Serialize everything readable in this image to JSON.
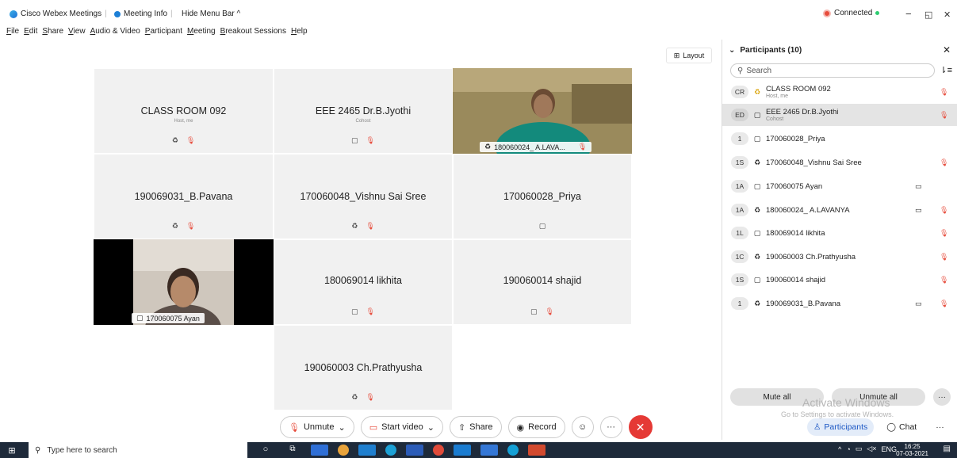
{
  "titlebar": {
    "app_name": "Cisco Webex Meetings",
    "meeting_info": "Meeting Info",
    "hide_menu": "Hide Menu Bar ^",
    "status": "Connected",
    "win_min": "−",
    "win_max": "◱",
    "win_close": "✕"
  },
  "menu": [
    "File",
    "Edit",
    "Share",
    "View",
    "Audio & Video",
    "Participant",
    "Meeting",
    "Breakout Sessions",
    "Help"
  ],
  "layout_label": "Layout",
  "tiles": {
    "classroom": {
      "name": "CLASS ROOM 092",
      "role": "Host, me"
    },
    "eee": {
      "name": "EEE 2465 Dr.B.Jyothi",
      "role": "Cohost"
    },
    "lavanya": {
      "name": "180060024_ A.LAVA..."
    },
    "pavana": {
      "name": "190069031_B.Pavana"
    },
    "vishnu": {
      "name": "170060048_Vishnu Sai Sree"
    },
    "priya": {
      "name": "170060028_Priya"
    },
    "ayan": {
      "name": "170060075 Ayan"
    },
    "likhita": {
      "name": "180069014 likhita"
    },
    "shajid": {
      "name": "190060014 shajid"
    },
    "prathyusha": {
      "name": "190060003 Ch.Prathyusha"
    }
  },
  "toolbar": {
    "unmute": "Unmute",
    "start_video": "Start video",
    "share": "Share",
    "record": "Record"
  },
  "panel": {
    "title": "Participants (10)",
    "search_placeholder": "Search",
    "participants": [
      {
        "initials": "CR",
        "name": "CLASS ROOM 092",
        "sub": "Host, me",
        "cam": false,
        "mic_muted": true
      },
      {
        "initials": "ED",
        "name": "EEE 2465 Dr.B.Jyothi",
        "sub": "Cohost",
        "cam": false,
        "mic_muted": true
      },
      {
        "initials": "1",
        "name": "170060028_Priya",
        "sub": "",
        "cam": false,
        "mic_muted": false
      },
      {
        "initials": "1S",
        "name": "170060048_Vishnu Sai Sree",
        "sub": "",
        "cam": false,
        "mic_muted": true
      },
      {
        "initials": "1A",
        "name": "170060075 Ayan",
        "sub": "",
        "cam": true,
        "mic_muted": false
      },
      {
        "initials": "1A",
        "name": "180060024_ A.LAVANYA",
        "sub": "",
        "cam": true,
        "mic_muted": true
      },
      {
        "initials": "1L",
        "name": "180069014 likhita",
        "sub": "",
        "cam": false,
        "mic_muted": true
      },
      {
        "initials": "1C",
        "name": "190060003 Ch.Prathyusha",
        "sub": "",
        "cam": false,
        "mic_muted": true
      },
      {
        "initials": "1S",
        "name": "190060014 shajid",
        "sub": "",
        "cam": false,
        "mic_muted": true
      },
      {
        "initials": "1",
        "name": "190069031_B.Pavana",
        "sub": "",
        "cam": true,
        "mic_muted": true
      }
    ],
    "mute_all": "Mute all",
    "unmute_all": "Unmute all",
    "tab_participants": "Participants",
    "tab_chat": "Chat"
  },
  "watermark": {
    "line1": "Activate Windows",
    "line2": "Go to Settings to activate Windows."
  },
  "taskbar": {
    "search_placeholder": "Type here to search",
    "lang": "ENG",
    "time": "16:25",
    "date": "07-03-2021"
  }
}
